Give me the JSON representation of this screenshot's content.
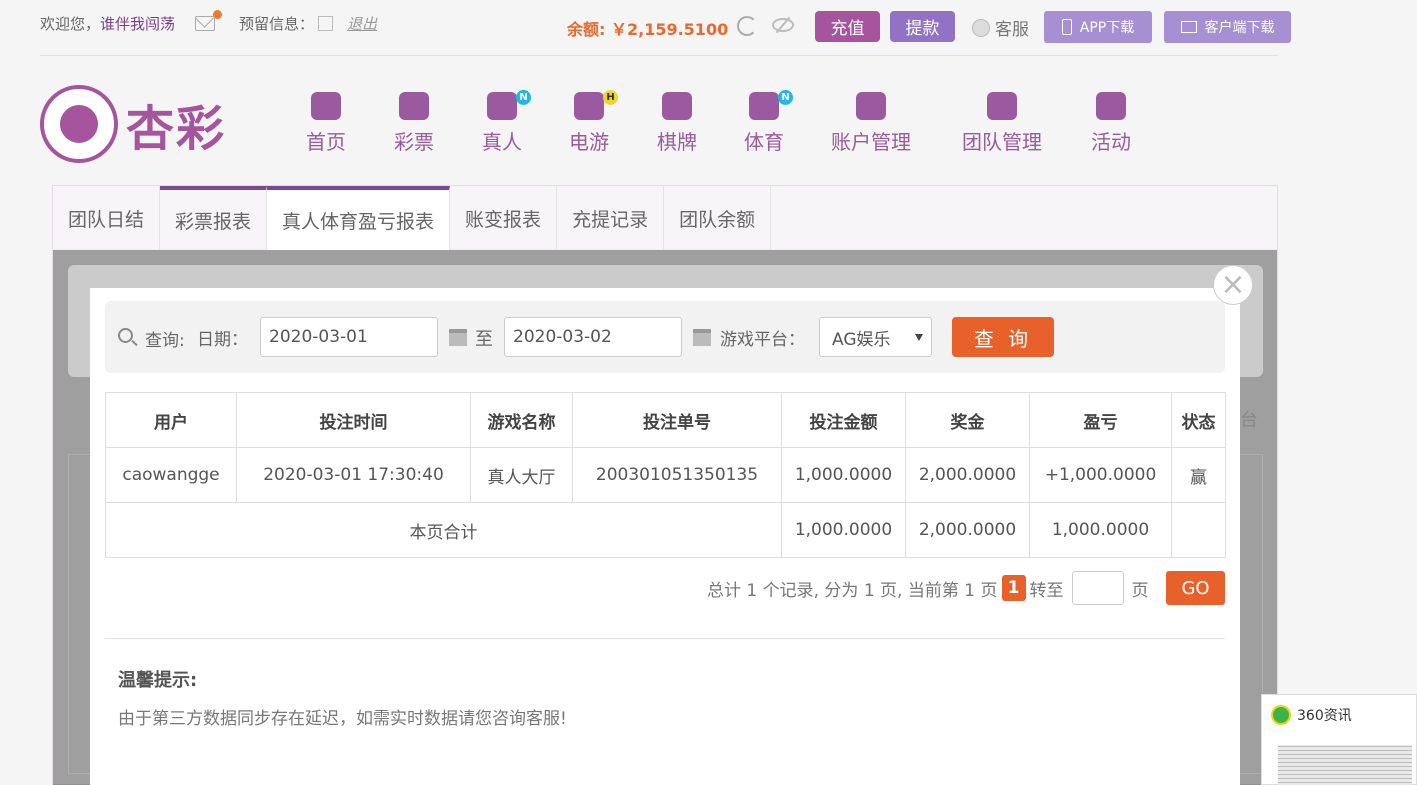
{
  "topbar": {
    "welcome": "欢迎您，",
    "username": "谁伴我闯荡",
    "reserve_label": "预留信息：",
    "logout": "退出",
    "balance_label": "余额:",
    "balance_value": "￥2,159.5100",
    "charge": "充值",
    "withdraw": "提款",
    "service": "客服",
    "app_download": "APP下载",
    "client_download": "客户端下载"
  },
  "logo": {
    "text": "杏彩"
  },
  "nav": [
    {
      "label": "首页",
      "icon": "home-icon",
      "badge": ""
    },
    {
      "label": "彩票",
      "icon": "lottery-icon",
      "badge": ""
    },
    {
      "label": "真人",
      "icon": "live-dealer-icon",
      "badge": "N"
    },
    {
      "label": "电游",
      "icon": "gamepad-icon",
      "badge": "H"
    },
    {
      "label": "棋牌",
      "icon": "cards-icon",
      "badge": ""
    },
    {
      "label": "体育",
      "icon": "trophy-icon",
      "badge": "N"
    },
    {
      "label": "账户管理",
      "icon": "yen-icon",
      "badge": ""
    },
    {
      "label": "团队管理",
      "icon": "team-icon",
      "badge": ""
    },
    {
      "label": "活动",
      "icon": "gift-icon",
      "badge": ""
    }
  ],
  "tabs": [
    "团队日结",
    "彩票报表",
    "真人体育盈亏报表",
    "账变报表",
    "充提记录",
    "团队余额"
  ],
  "background": {
    "partial_text": "台"
  },
  "modal": {
    "query_label": "查询:",
    "date_label": "日期：",
    "date_from": "2020-03-01",
    "to_label": "至",
    "date_to": "2020-03-02",
    "platform_label": "游戏平台：",
    "platform_value": "AG娱乐",
    "query_button": "查 询",
    "table": {
      "headers": [
        "用户",
        "投注时间",
        "游戏名称",
        "投注单号",
        "投注金额",
        "奖金",
        "盈亏",
        "状态"
      ],
      "rows": [
        {
          "user": "caowangge",
          "time": "2020-03-01 17:30:40",
          "game": "真人大厅",
          "order": "200301051350135",
          "bet": "1,000.0000",
          "prize": "2,000.0000",
          "profit": "+1,000.0000",
          "status": "赢"
        }
      ],
      "total": {
        "label": "本页合计",
        "bet": "1,000.0000",
        "prize": "2,000.0000",
        "profit": "1,000.0000"
      }
    },
    "pager": {
      "summary": "总计 1 个记录, 分为 1 页, 当前第 1 页",
      "current": "1",
      "goto_label": "转至",
      "page_unit": "页",
      "go": "GO"
    },
    "tip_title": "温馨提示:",
    "tip_text": "由于第三方数据同步存在延迟，如需实时数据请您咨询客服!"
  },
  "widget": {
    "title": "360资讯"
  },
  "colors": {
    "accent": "#a5549d",
    "orange": "#e8612a",
    "profit_green": "#128c12",
    "loss_red": "#e01515"
  }
}
